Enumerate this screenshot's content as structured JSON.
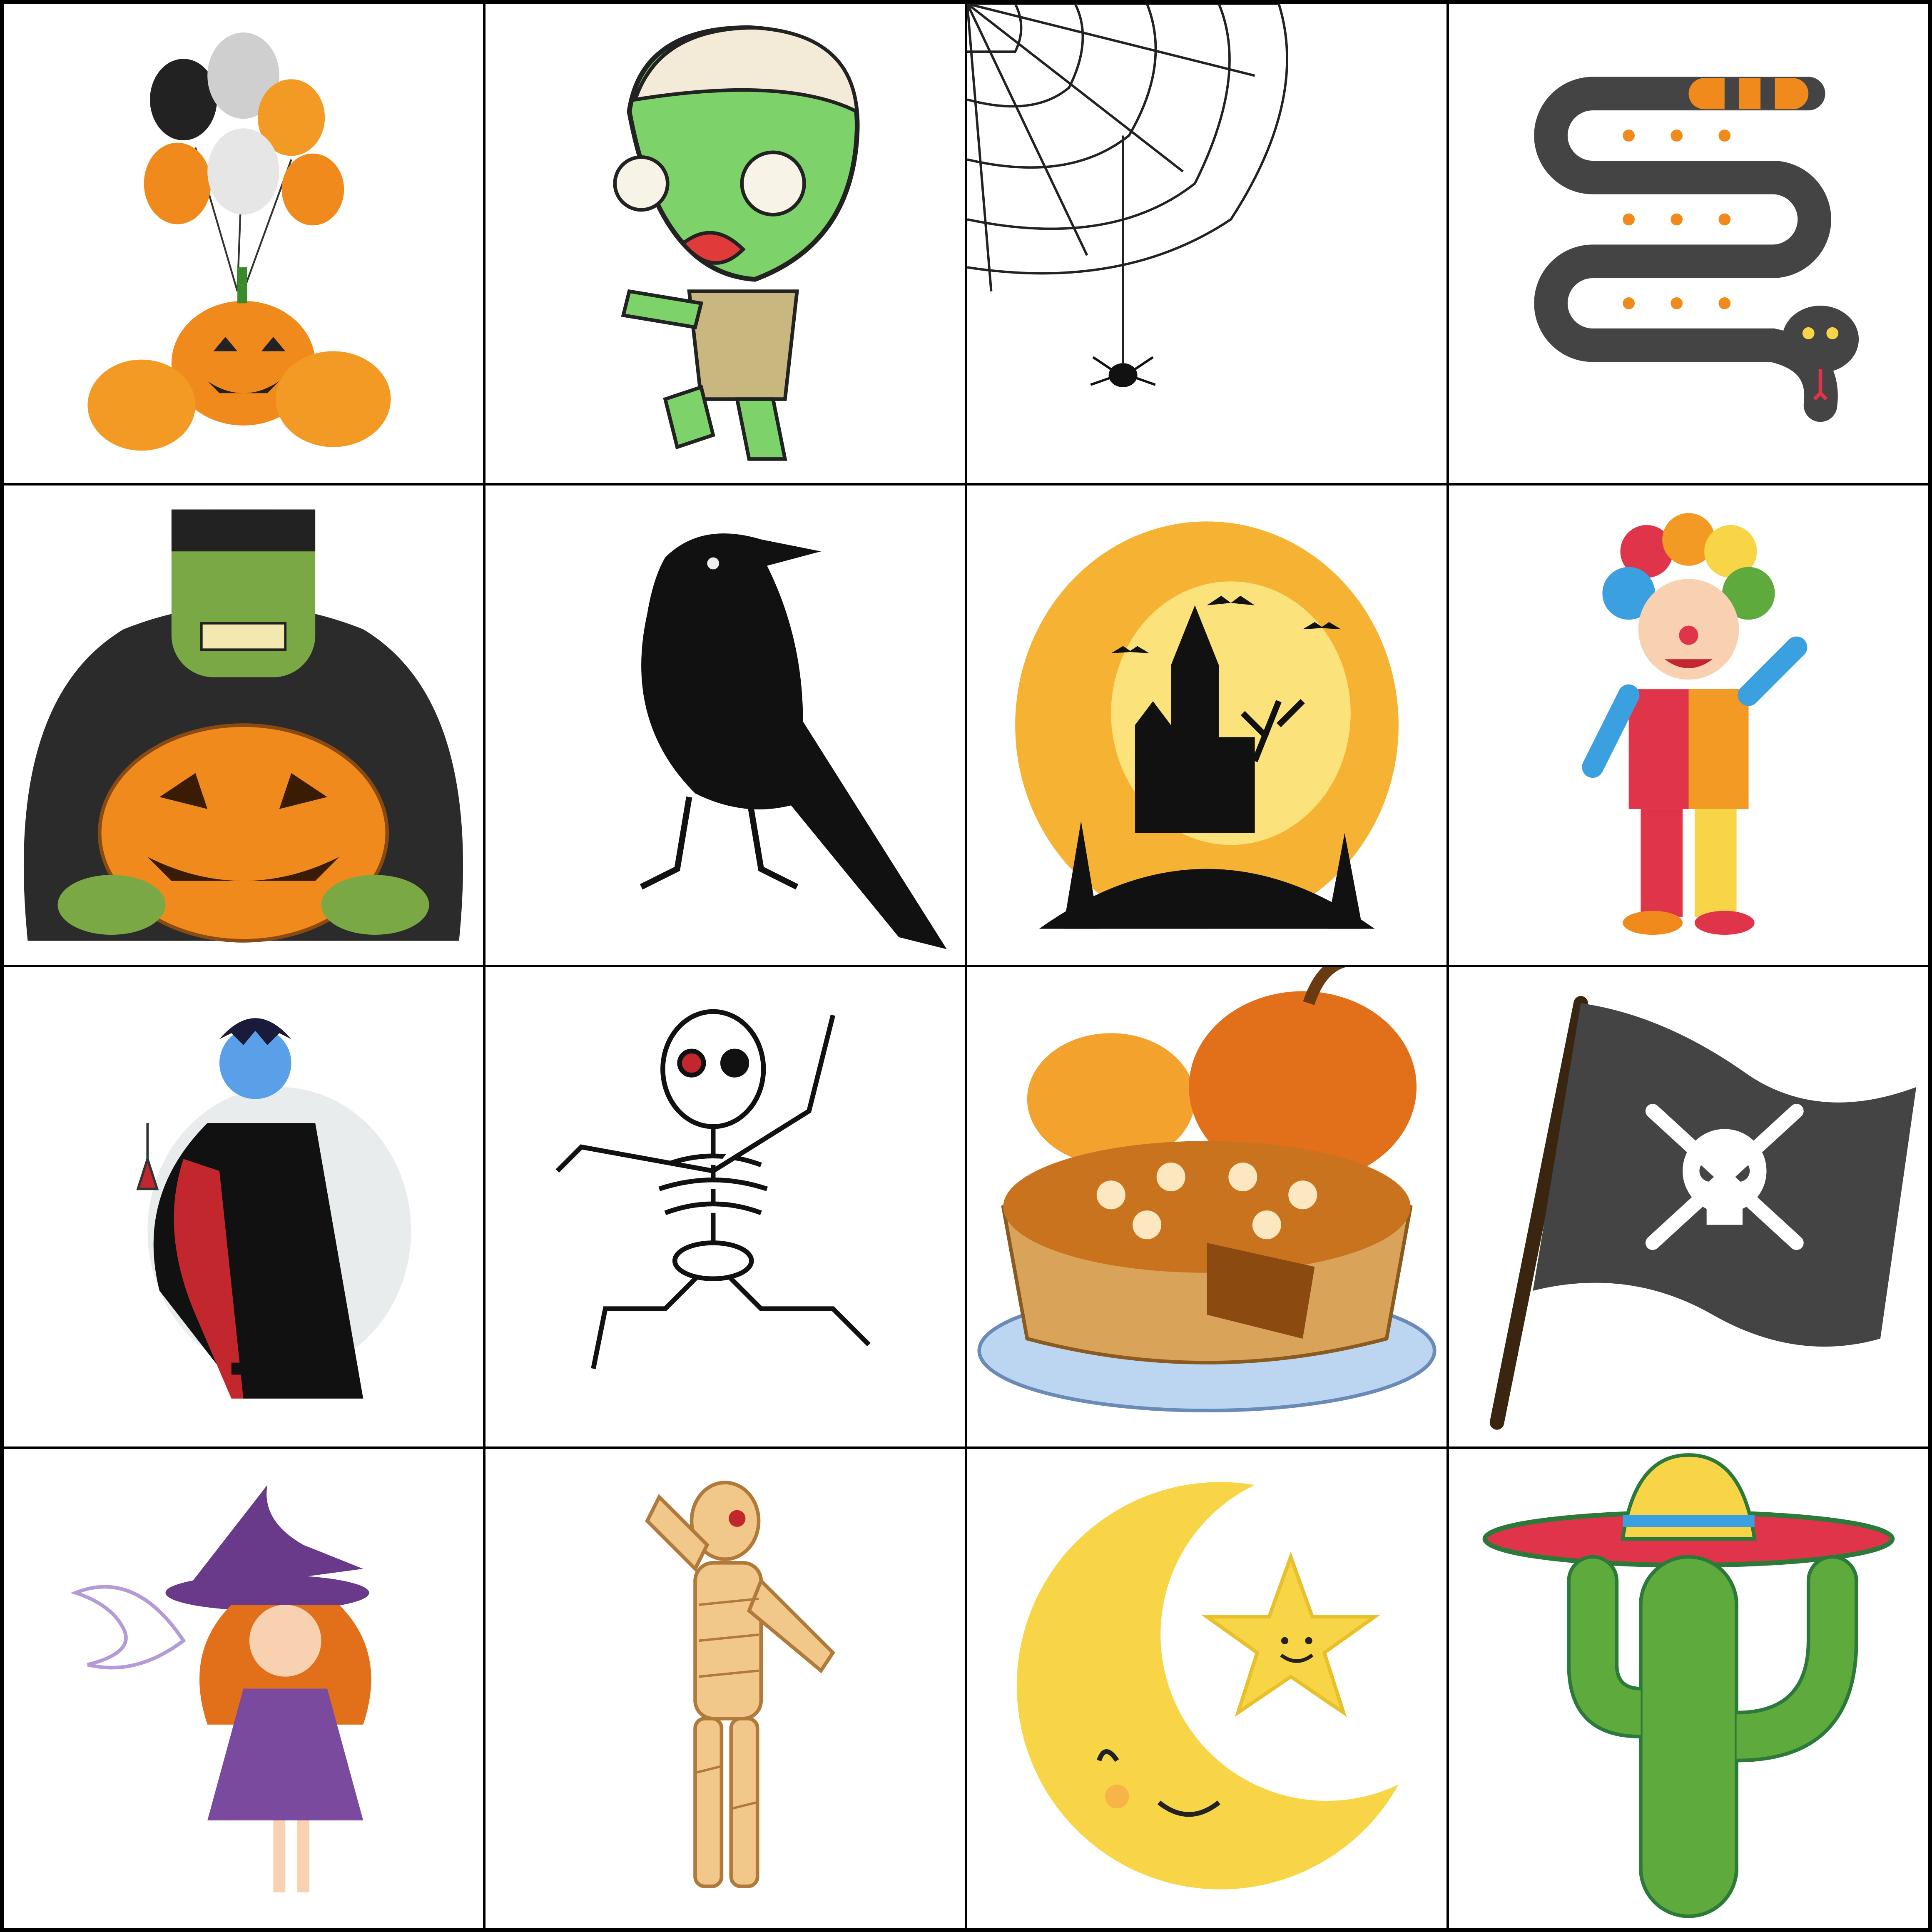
{
  "grid": {
    "rows": 4,
    "columns": 4,
    "cells": [
      {
        "icon": "pumpkins-balloons-icon"
      },
      {
        "icon": "zombie-icon"
      },
      {
        "icon": "spider-web-icon"
      },
      {
        "icon": "snake-icon"
      },
      {
        "icon": "frankenstein-pumpkin-icon"
      },
      {
        "icon": "crow-icon"
      },
      {
        "icon": "haunted-castle-icon"
      },
      {
        "icon": "clown-kid-icon"
      },
      {
        "icon": "vampire-icon"
      },
      {
        "icon": "skeleton-icon"
      },
      {
        "icon": "pumpkin-pie-icon"
      },
      {
        "icon": "pirate-flag-icon"
      },
      {
        "icon": "witch-girl-icon"
      },
      {
        "icon": "mummy-icon"
      },
      {
        "icon": "moon-star-icon"
      },
      {
        "icon": "cactus-sombrero-icon"
      }
    ]
  },
  "colors": {
    "border": "#000000",
    "pumpkin": "#f08a1c",
    "zombie_green": "#7dd36a",
    "black": "#111111",
    "moon_yellow": "#f7d547",
    "cactus_green": "#5faa3c"
  }
}
